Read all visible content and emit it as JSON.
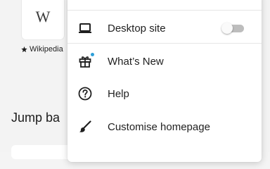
{
  "background": {
    "shortcut_tile": {
      "letter": "W",
      "label": "Wikipedia",
      "pin_icon": "pin-icon"
    },
    "section_heading": "Jump ba"
  },
  "menu": {
    "items": [
      {
        "id": "desktop-site",
        "label": "Desktop site",
        "icon": "laptop-icon",
        "toggle_on": false
      },
      {
        "id": "whats-new",
        "label": "What’s New",
        "icon": "gift-icon",
        "badge": true
      },
      {
        "id": "help",
        "label": "Help",
        "icon": "help-circle-icon"
      },
      {
        "id": "customise-homepage",
        "label": "Customise homepage",
        "icon": "paintbrush-icon"
      }
    ]
  },
  "colors": {
    "badge": "#2d9fd8",
    "toggle_track": "#bdbdbd",
    "text": "#1f1f1f"
  }
}
